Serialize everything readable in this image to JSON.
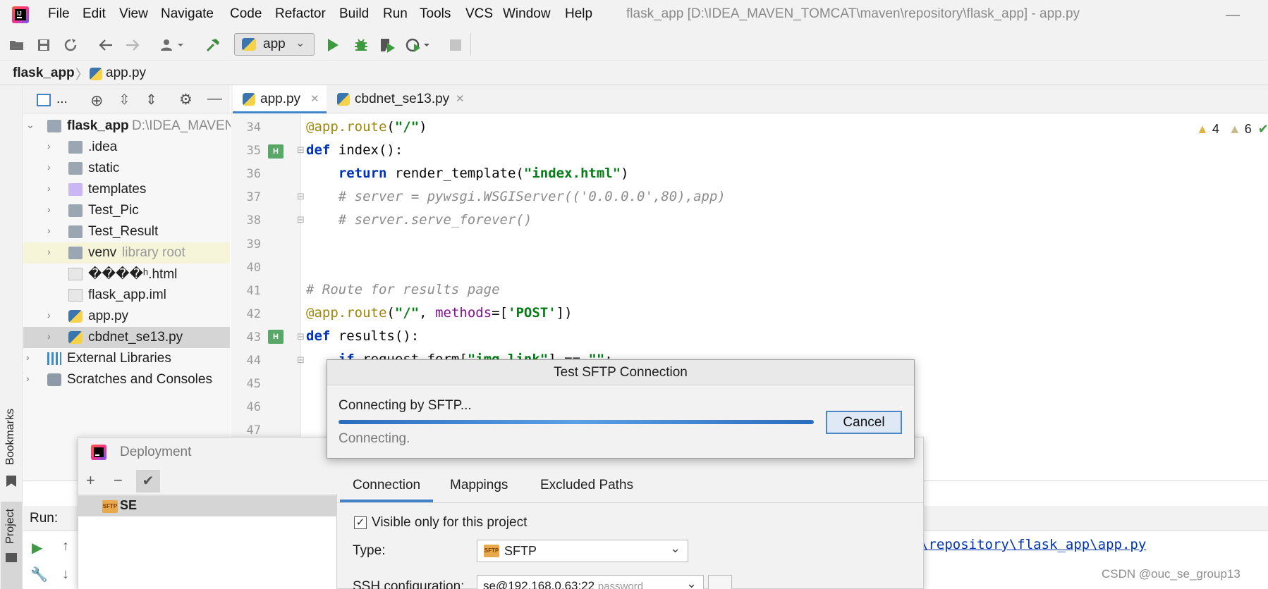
{
  "menubar": {
    "items": [
      "File",
      "Edit",
      "View",
      "Navigate",
      "Code",
      "Refactor",
      "Build",
      "Run",
      "Tools",
      "VCS",
      "Window",
      "Help"
    ],
    "title": "flask_app [D:\\IDEA_MAVEN_TOMCAT\\maven\\repository\\flask_app] - app.py",
    "minimize": "—"
  },
  "toolbar": {
    "run_config": "app",
    "icons": [
      "open-folder-icon",
      "save-icon",
      "sync-icon",
      "back-icon",
      "forward-icon",
      "user-icon",
      "build-hammer-icon",
      "run-icon",
      "debug-icon",
      "coverage-icon",
      "profile-icon",
      "stop-icon"
    ]
  },
  "breadcrumb": {
    "project": "flask_app",
    "separator": "〉",
    "file": "app.py"
  },
  "left_stripe": {
    "bookmarks": "Bookmarks",
    "project": "Project"
  },
  "project_panel": {
    "header_label": "...",
    "root": {
      "name": "flask_app",
      "path": "D:\\IDEA_MAVEN"
    },
    "items": [
      {
        "name": ".idea",
        "note": ""
      },
      {
        "name": "static",
        "note": ""
      },
      {
        "name": "templates",
        "note": ""
      },
      {
        "name": "Test_Pic",
        "note": ""
      },
      {
        "name": "Test_Result",
        "note": ""
      },
      {
        "name": "venv",
        "note": "library root"
      },
      {
        "name": "����ʰ.html",
        "note": ""
      },
      {
        "name": "flask_app.iml",
        "note": ""
      },
      {
        "name": "app.py",
        "note": ""
      },
      {
        "name": "cbdnet_se13.py",
        "note": ""
      }
    ],
    "external": "External Libraries",
    "scratches": "Scratches and Consoles"
  },
  "editor": {
    "tabs": [
      "app.py",
      "cbdnet_se13.py"
    ],
    "line_numbers": [
      "34",
      "35",
      "36",
      "37",
      "38",
      "39",
      "40",
      "41",
      "42",
      "43",
      "44",
      "45",
      "46",
      "47"
    ],
    "inspections": {
      "warnings_a": "4",
      "warnings_b": "6"
    }
  },
  "run_panel": {
    "label": "Run:",
    "link": "\\repository\\flask_app\\app.py"
  },
  "deployment": {
    "title": "Deployment",
    "tools": [
      "+",
      "−",
      "✔"
    ],
    "server": "SE",
    "tabs": [
      "Connection",
      "Mappings",
      "Excluded Paths"
    ],
    "visible_label": "Visible only for this project",
    "type_label": "Type:",
    "type_value": "SFTP",
    "ssh_label": "SSH configuration:",
    "ssh_value": "se@192.168.0.63:22",
    "ssh_hint": "password"
  },
  "sftp_dialog": {
    "title": "Test SFTP Connection",
    "message": "Connecting by SFTP...",
    "status": "Connecting.",
    "cancel": "Cancel",
    "progress": 1.0
  },
  "watermark": "CSDN @ouc_se_group13",
  "colors": {
    "accent": "#4083c9",
    "keyword": "#0033b3",
    "string": "#067d17",
    "comment": "#8c8c8c",
    "decorator": "#9e880d"
  }
}
